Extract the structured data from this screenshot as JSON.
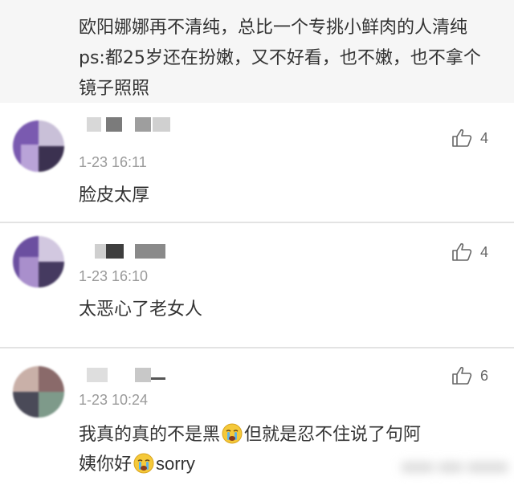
{
  "top_comment": {
    "text": "欧阳娜娜再不清纯，总比一个专挑小鲜肉的人清纯 ps:都25岁还在扮嫩，又不好看，也不嫩，也不拿个镜子照照"
  },
  "comments": [
    {
      "timestamp": "1-23 16:11",
      "content": "脸皮太厚",
      "likes": "4",
      "avatar_colors": [
        "#7a5ab0",
        "#b9a3d8",
        "#3b3150",
        "#c9c0d8"
      ]
    },
    {
      "timestamp": "1-23 16:10",
      "content": "太恶心了老女人",
      "likes": "4",
      "avatar_colors": [
        "#6b4fa0",
        "#a98fcc",
        "#453a60",
        "#d2c8e0"
      ]
    },
    {
      "timestamp": "1-23 10:24",
      "content_part1": "我真的真的不是黑",
      "content_part2": "但就是忍不住说了句阿",
      "content_part3": "姨你好",
      "content_part4": "sorry",
      "likes": "6",
      "avatar_colors": [
        "#8a6a6a",
        "#c9b0a8",
        "#4a4a58",
        "#7e9a8a"
      ]
    }
  ],
  "icons": {
    "like": "thumbs-up-icon",
    "emoji": "crying-face-icon"
  },
  "colors": {
    "timestamp": "#9a9a9a",
    "divider": "#e3e3e3",
    "top_background": "#f6f6f6"
  }
}
